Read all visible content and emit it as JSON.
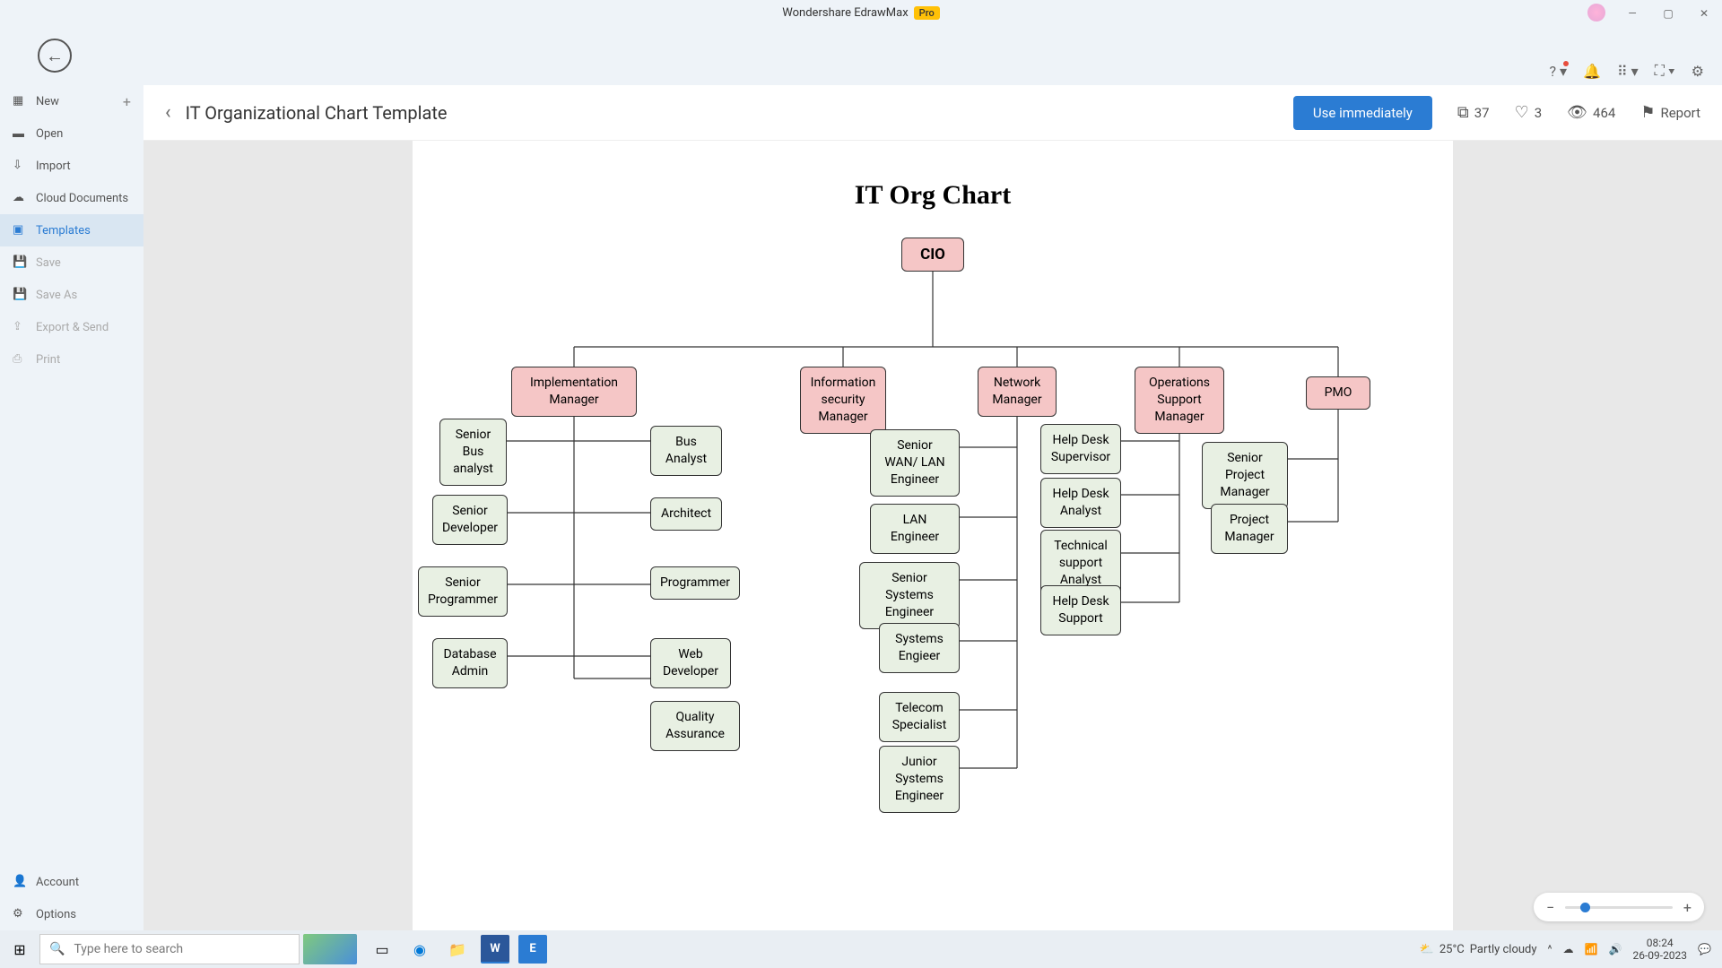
{
  "app": {
    "title": "Wondershare EdrawMax",
    "badge": "Pro"
  },
  "sidebar": {
    "new": "New",
    "open": "Open",
    "import": "Import",
    "cloud": "Cloud Documents",
    "templates": "Templates",
    "save": "Save",
    "saveas": "Save As",
    "export": "Export & Send",
    "print": "Print",
    "account": "Account",
    "options": "Options"
  },
  "header": {
    "title": "IT Organizational Chart Template",
    "use_btn": "Use immediately",
    "copies": "37",
    "likes": "3",
    "views": "464",
    "report": "Report"
  },
  "chart": {
    "title": "IT Org Chart",
    "cio": "CIO",
    "impl_mgr": "Implementation Manager",
    "infosec_mgr": "Information security Manager",
    "net_mgr": "Network Manager",
    "ops_mgr": "Operations Support Manager",
    "pmo": "PMO",
    "sr_bus": "Senior Bus analyst",
    "bus_analyst": "Bus Analyst",
    "sr_dev": "Senior Developer",
    "architect": "Architect",
    "sr_prog": "Senior Programmer",
    "programmer": "Programmer",
    "db_admin": "Database Admin",
    "web_dev": "Web Developer",
    "qa": "Quality Assurance",
    "sr_wan": "Senior WAN/ LAN Engineer",
    "lan_eng": "LAN Engineer",
    "sr_sys": "Senior Systems Engineer",
    "sys_eng": "Systems Engieer",
    "telecom": "Telecom Specialist",
    "jr_sys": "Junior Systems Engineer",
    "hd_sup": "Help Desk Supervisor",
    "hd_analyst": "Help Desk Analyst",
    "tech_sup": "Technical support Analyst",
    "hd_support": "Help Desk Support",
    "sr_pm": "Senior Project Manager",
    "pm": "Project Manager"
  },
  "taskbar": {
    "search_placeholder": "Type here to search",
    "weather_temp": "25°C",
    "weather_desc": "Partly cloudy",
    "time": "08:24",
    "date": "26-09-2023"
  }
}
